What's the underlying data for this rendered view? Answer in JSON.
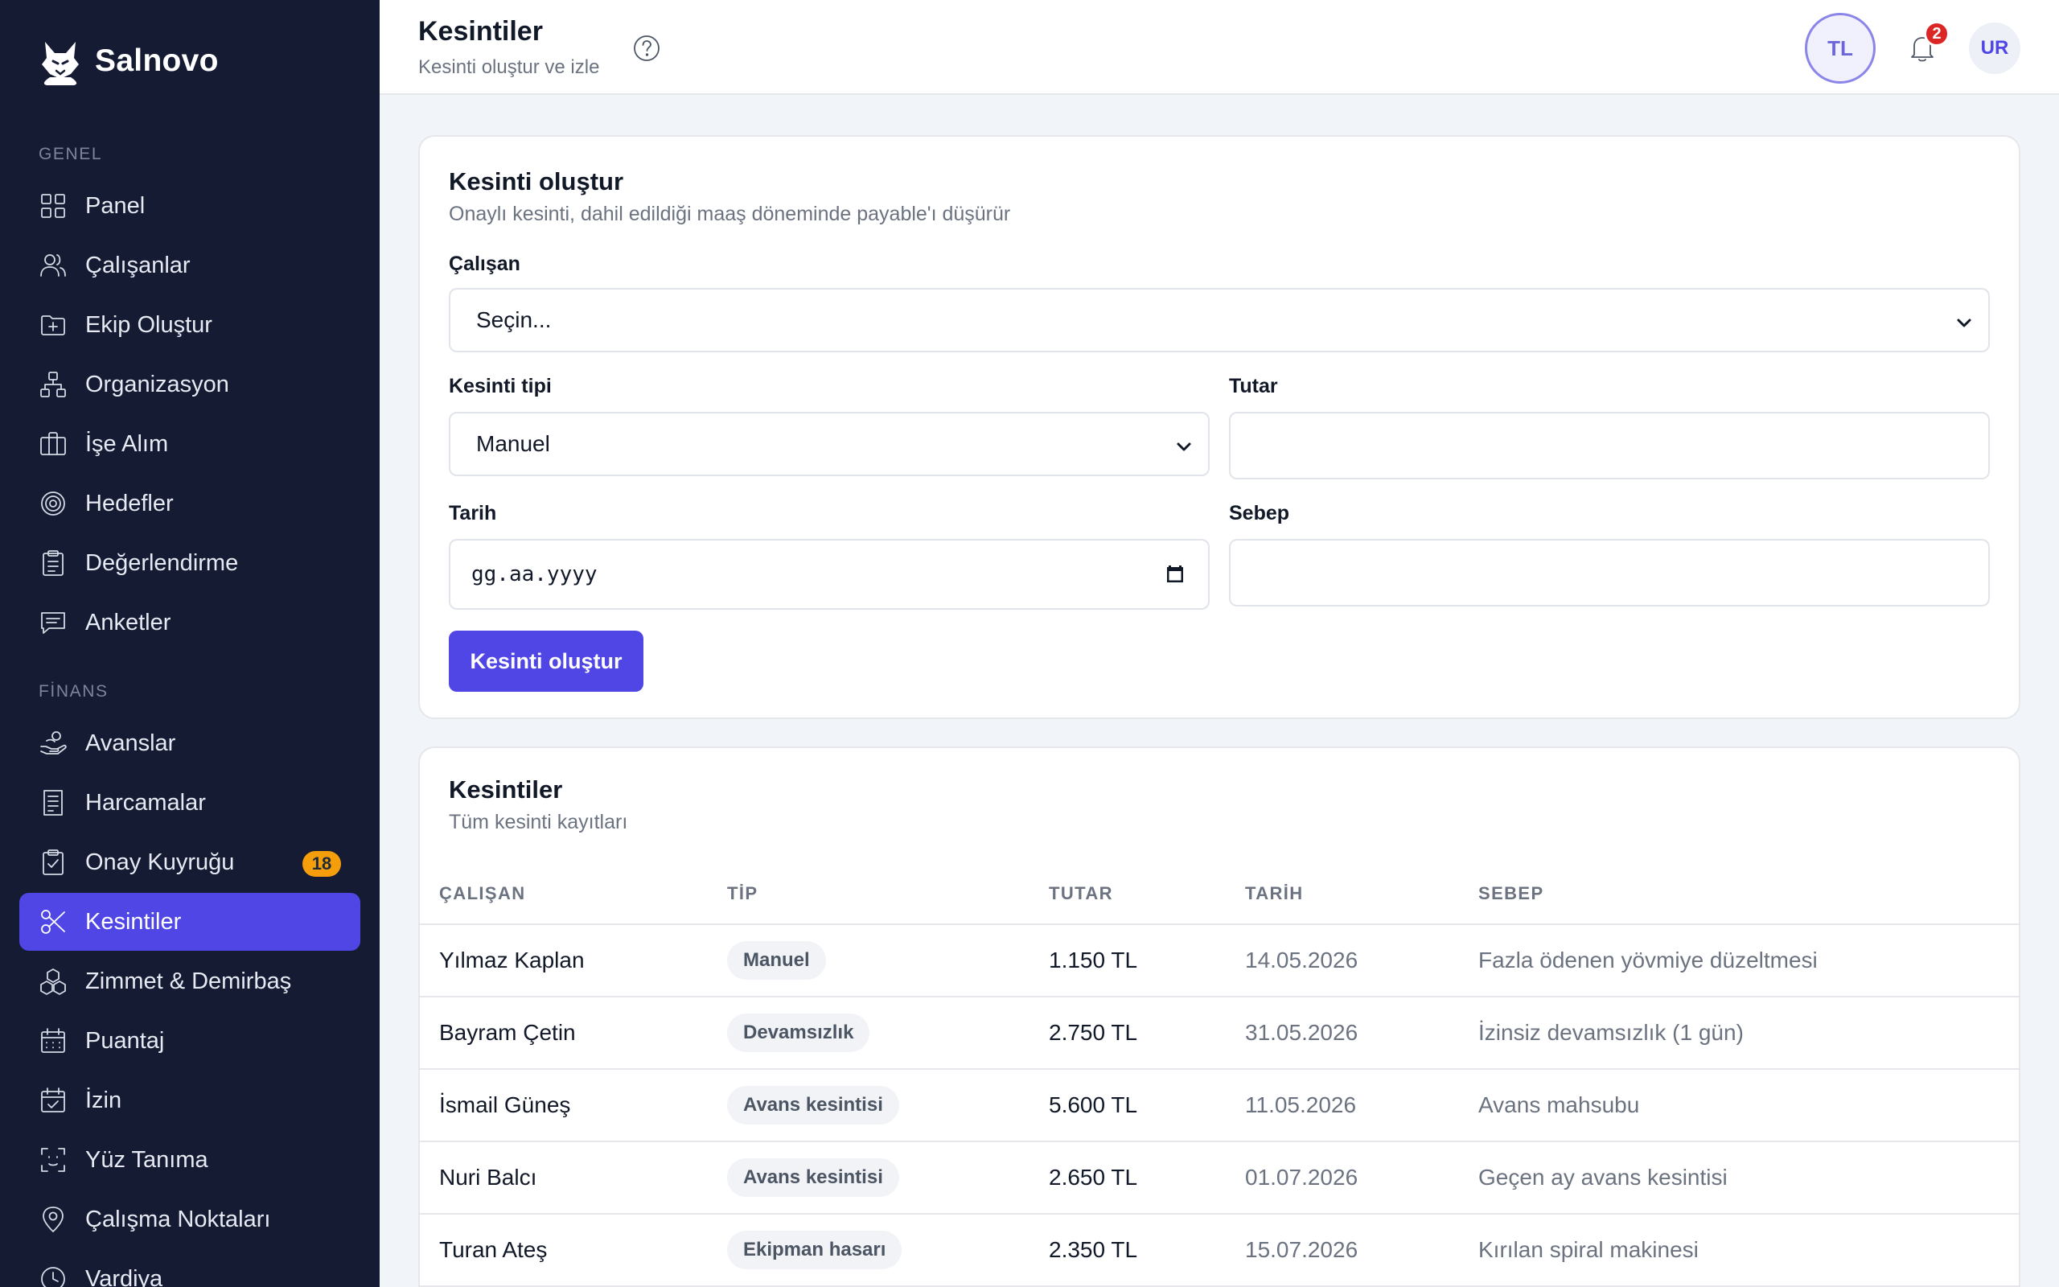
{
  "app": {
    "name": "Salnovo"
  },
  "sidebar": {
    "sections": [
      {
        "title": "GENEL"
      },
      {
        "title": "FİNANS"
      }
    ],
    "items": [
      {
        "label": "Panel",
        "icon": "grid-icon"
      },
      {
        "label": "Çalışanlar",
        "icon": "users-icon"
      },
      {
        "label": "Ekip Oluştur",
        "icon": "folder-plus-icon"
      },
      {
        "label": "Organizasyon",
        "icon": "org-chart-icon"
      },
      {
        "label": "İşe Alım",
        "icon": "briefcase-icon"
      },
      {
        "label": "Hedefler",
        "icon": "target-icon"
      },
      {
        "label": "Değerlendirme",
        "icon": "clipboard-list-icon"
      },
      {
        "label": "Anketler",
        "icon": "message-icon"
      },
      {
        "label": "Avanslar",
        "icon": "hand-coins-icon"
      },
      {
        "label": "Harcamalar",
        "icon": "receipt-icon"
      },
      {
        "label": "Onay Kuyruğu",
        "icon": "clipboard-check-icon",
        "badge": "18"
      },
      {
        "label": "Kesintiler",
        "icon": "scissors-icon",
        "active": true
      },
      {
        "label": "Zimmet & Demirbaş",
        "icon": "boxes-icon"
      },
      {
        "label": "Puantaj",
        "icon": "calendar-grid-icon"
      },
      {
        "label": "İzin",
        "icon": "calendar-check-icon"
      },
      {
        "label": "Yüz Tanıma",
        "icon": "face-scan-icon"
      },
      {
        "label": "Çalışma Noktaları",
        "icon": "map-pin-icon"
      },
      {
        "label": "Vardiya",
        "icon": "clock-icon"
      }
    ]
  },
  "header": {
    "title": "Kesintiler",
    "subtitle": "Kesinti oluştur ve izle",
    "currency": "TL",
    "notification_count": "2",
    "user_initials": "UR"
  },
  "form": {
    "title": "Kesinti oluştur",
    "description": "Onaylı kesinti, dahil edildiği maaş döneminde payable'ı düşürür",
    "employee_label": "Çalışan",
    "employee_value": "Seçin...",
    "type_label": "Kesinti tipi",
    "type_value": "Manuel",
    "amount_label": "Tutar",
    "amount_value": "",
    "date_label": "Tarih",
    "date_placeholder": "gg.aa.yyyy",
    "reason_label": "Sebep",
    "reason_value": "",
    "submit_label": "Kesinti oluştur"
  },
  "list": {
    "title": "Kesintiler",
    "description": "Tüm kesinti kayıtları",
    "columns": [
      "ÇALIŞAN",
      "TİP",
      "TUTAR",
      "TARİH",
      "SEBEP"
    ],
    "rows": [
      {
        "employee": "Yılmaz Kaplan",
        "type": "Manuel",
        "amount": "1.150 TL",
        "date": "14.05.2026",
        "reason": "Fazla ödenen yövmiye düzeltmesi"
      },
      {
        "employee": "Bayram Çetin",
        "type": "Devamsızlık",
        "amount": "2.750 TL",
        "date": "31.05.2026",
        "reason": "İzinsiz devamsızlık (1 gün)"
      },
      {
        "employee": "İsmail Güneş",
        "type": "Avans kesintisi",
        "amount": "5.600 TL",
        "date": "11.05.2026",
        "reason": "Avans mahsubu"
      },
      {
        "employee": "Nuri Balcı",
        "type": "Avans kesintisi",
        "amount": "2.650 TL",
        "date": "01.07.2026",
        "reason": "Geçen ay avans kesintisi"
      },
      {
        "employee": "Turan Ateş",
        "type": "Ekipman hasarı",
        "amount": "2.350 TL",
        "date": "15.07.2026",
        "reason": "Kırılan spiral makinesi"
      }
    ]
  },
  "colors": {
    "sidebar_bg": "#141b33",
    "accent": "#4f46e5",
    "badge_warning": "#f59e0b",
    "badge_danger": "#dc2626"
  }
}
